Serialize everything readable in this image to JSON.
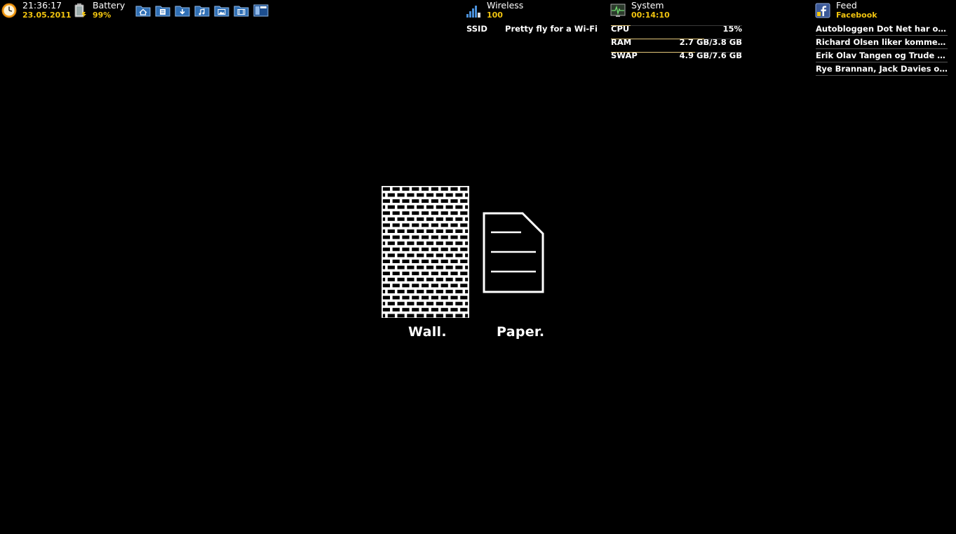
{
  "clock": {
    "time": "21:36:17",
    "date": "23.05.2011",
    "icon": "clock-icon"
  },
  "battery": {
    "title": "Battery",
    "value": "99%",
    "icon": "battery-icon"
  },
  "folders": [
    {
      "name": "home-folder-icon"
    },
    {
      "name": "documents-folder-icon"
    },
    {
      "name": "downloads-folder-icon"
    },
    {
      "name": "music-folder-icon"
    },
    {
      "name": "pictures-folder-icon"
    },
    {
      "name": "videos-folder-icon"
    },
    {
      "name": "desktop-folder-icon"
    }
  ],
  "wireless": {
    "title": "Wireless",
    "value": "100",
    "ssid_label": "SSID",
    "ssid_value": "Pretty fly for a Wi-Fi",
    "icon": "wireless-signal-icon"
  },
  "system": {
    "title": "System",
    "uptime": "00:14:10",
    "icon": "system-monitor-icon",
    "cpu": {
      "label": "CPU",
      "value": "15%",
      "fill": 0.15
    },
    "ram": {
      "label": "RAM",
      "value": "2.7 GB/3.8 GB",
      "fill": 0.71
    },
    "swap": {
      "label": "SWAP",
      "value": "4.9 GB/7.6 GB",
      "fill": 0.64
    }
  },
  "feed": {
    "title": "Feed",
    "source": "Facebook",
    "icon": "facebook-feed-icon",
    "items": [
      "Autobloggen Dot Net har også kommentert",
      "Richard Olsen liker kommentaren din",
      "Erik Olav Tangen og Trude Hoel Hansen",
      "Rye Brannan, Jack Davies og Lorraine"
    ]
  },
  "wallpaper": {
    "wall_caption": "Wall.",
    "paper_caption": "Paper."
  },
  "colors": {
    "accent": "#f1c40f",
    "background": "#000000",
    "bar": "#e6c97a"
  }
}
